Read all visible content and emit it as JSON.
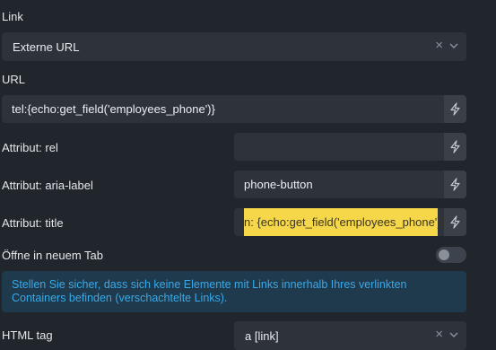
{
  "link": {
    "label": "Link",
    "value": "Externe URL"
  },
  "url": {
    "label": "URL",
    "value": "tel:{echo:get_field('employees_phone')}"
  },
  "attr_rel": {
    "label": "Attribut: rel",
    "value": ""
  },
  "attr_aria": {
    "label": "Attribut: aria-label",
    "value": "phone-button"
  },
  "attr_title": {
    "label": "Attribut: title",
    "value": "n: {echo:get_field('employees_phone')}"
  },
  "new_tab": {
    "label": "Öffne in neuem Tab",
    "enabled": false
  },
  "notice": {
    "text": "Stellen Sie sicher, dass sich keine Elemente mit Links innerhalb Ihres verlinkten Containers befinden (verschachtelte Links)."
  },
  "html_tag": {
    "label": "HTML tag",
    "value": "a [link]"
  },
  "colors": {
    "background": "#21252c",
    "field": "#2e333b",
    "highlight": "#f6d74a",
    "notice_bg": "#1f3a4d",
    "notice_text": "#39a9e8"
  }
}
